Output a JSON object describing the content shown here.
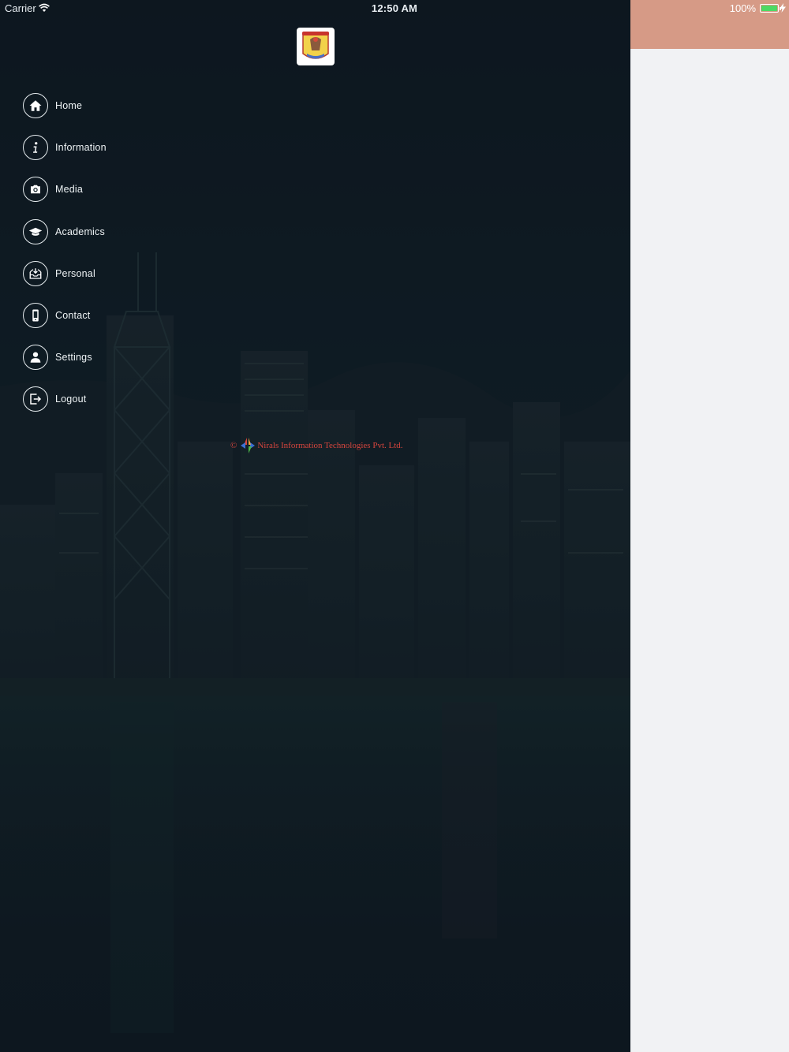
{
  "status_bar": {
    "carrier": "Carrier",
    "time": "12:50 AM",
    "battery": "100%"
  },
  "menu": [
    {
      "label": "Home",
      "icon": "home-icon"
    },
    {
      "label": "Information",
      "icon": "info-icon"
    },
    {
      "label": "Media",
      "icon": "camera-icon"
    },
    {
      "label": "Academics",
      "icon": "graduation-cap-icon"
    },
    {
      "label": "Personal",
      "icon": "inbox-download-icon"
    },
    {
      "label": "Contact",
      "icon": "mobile-phone-icon"
    },
    {
      "label": "Settings",
      "icon": "user-icon"
    },
    {
      "label": "Logout",
      "icon": "logout-icon"
    }
  ],
  "footer": {
    "copyright_symbol": "©",
    "company": "Nirals Information Technologies Pvt. Ltd."
  },
  "colors": {
    "drawer_bg": "#111c24",
    "header_accent": "#d69a86",
    "copyright_text": "#d6453d",
    "battery": "#4cd964"
  }
}
